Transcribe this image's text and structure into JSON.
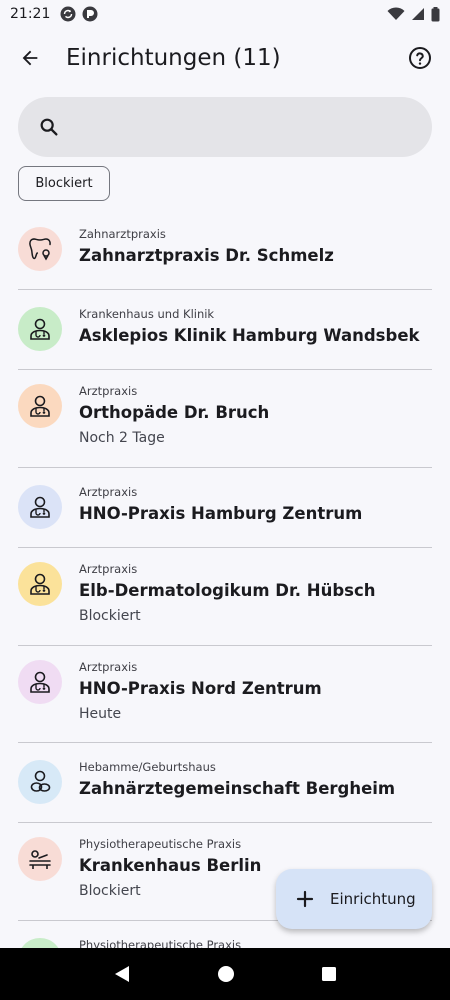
{
  "status_bar": {
    "time": "21:21",
    "icons_left": [
      "sync-icon",
      "app-notification-icon"
    ],
    "icons_right": [
      "wifi-icon",
      "signal-icon",
      "battery-icon"
    ]
  },
  "app_bar": {
    "title": "Einrichtungen (11)",
    "back_icon": "arrow-left-icon",
    "help_icon": "help-circle-icon"
  },
  "search": {
    "placeholder": "",
    "value": ""
  },
  "filter_chip": {
    "label": "Blockiert"
  },
  "items": [
    {
      "category": "Zahnarztpraxis",
      "name": "Zahnarztpraxis Dr. Schmelz",
      "status": "",
      "icon": "tooth-icon",
      "color": "#f8dcd6"
    },
    {
      "category": "Krankenhaus und Klinik",
      "name": "Asklepios Klinik Hamburg Wandsbek",
      "status": "",
      "icon": "doctor-icon",
      "color": "#c8ecc8"
    },
    {
      "category": "Arztpraxis",
      "name": "Orthopäde Dr. Bruch",
      "status": "Noch 2 Tage",
      "icon": "doctor-icon",
      "color": "#fbd9bf"
    },
    {
      "category": "Arztpraxis",
      "name": "HNO-Praxis Hamburg Zentrum",
      "status": "",
      "icon": "doctor-icon",
      "color": "#dbe3f7"
    },
    {
      "category": "Arztpraxis",
      "name": "Elb-Dermatologikum Dr. Hübsch",
      "status": "Blockiert",
      "icon": "doctor-icon",
      "color": "#fbe29a"
    },
    {
      "category": "Arztpraxis",
      "name": "HNO-Praxis Nord Zentrum",
      "status": "Heute",
      "icon": "doctor-icon",
      "color": "#f0dcf3"
    },
    {
      "category": "Hebamme/Geburtshaus",
      "name": "Zahnärztegemeinschaft Bergheim",
      "status": "",
      "icon": "midwife-icon",
      "color": "#d7e9f7"
    },
    {
      "category": "Physiotherapeutische Praxis",
      "name": "Krankenhaus Berlin",
      "status": "Blockiert",
      "icon": "massage-icon",
      "color": "#f8dcd6"
    },
    {
      "category": "Physiotherapeutische Praxis",
      "name": "",
      "status": "",
      "icon": "massage-icon",
      "color": "#c8ecc8"
    }
  ],
  "fab": {
    "label": "Einrichtung",
    "icon": "plus-icon"
  },
  "nav_bar": {
    "icons": [
      "back-triangle-icon",
      "home-circle-icon",
      "recents-square-icon"
    ]
  }
}
